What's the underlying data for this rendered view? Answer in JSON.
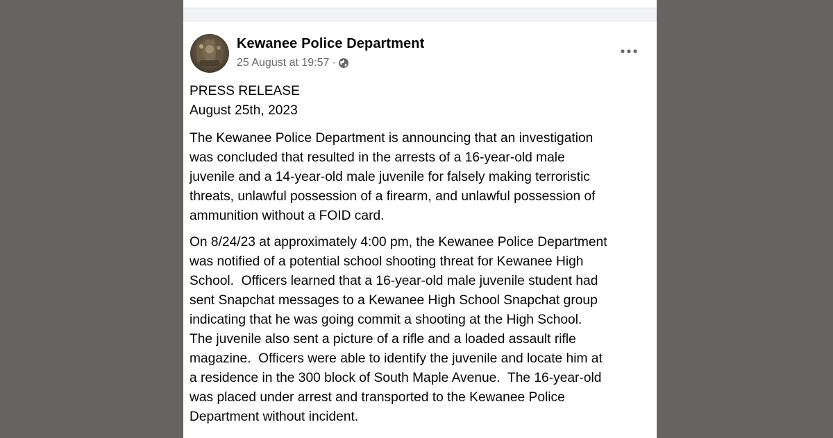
{
  "post": {
    "author": "Kewanee Police Department",
    "timestamp": "25 August at 19:57",
    "separator": "·",
    "privacy_icon": "globe-icon",
    "more_icon": "more-options-icon",
    "heading_lines": [
      "PRESS RELEASE",
      "August 25th, 2023"
    ],
    "paragraph1_lines": [
      "The Kewanee Police Department is announcing that an investigation",
      "was concluded that resulted in the arrests of a 16-year-old male",
      "juvenile and a 14-year-old male juvenile for falsely making terroristic",
      "threats, unlawful possession of a firearm, and unlawful possession of",
      "ammunition without a FOID card."
    ],
    "paragraph2_lines": [
      "On 8/24/23 at approximately 4:00 pm, the Kewanee Police Department",
      "was notified of a potential school shooting threat for Kewanee High",
      "School.  Officers learned that a 16-year-old male juvenile student had",
      "sent Snapchat messages to a Kewanee High School Snapchat group",
      "indicating that he was going commit a shooting at the High School.",
      "The juvenile also sent a picture of a rifle and a loaded assault rifle",
      "magazine.  Officers were able to identify the juvenile and locate him at",
      "a residence in the 300 block of South Maple Avenue.  The 16-year-old",
      "was placed under arrest and transported to the Kewanee Police",
      "Department without incident."
    ]
  },
  "colors": {
    "page_background": "#656463",
    "card_background": "#ffffff",
    "text_primary": "#050505",
    "text_secondary": "#65676b"
  }
}
